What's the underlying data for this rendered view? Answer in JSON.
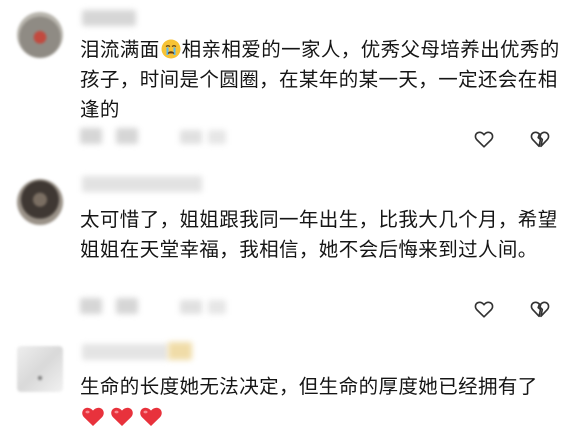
{
  "comments": [
    {
      "avatar_icon": "blurred-avatar",
      "text_before_emoji": "泪流满面",
      "emoji": "crying-face-icon",
      "text_after_emoji": "相亲相爱的一家人，优秀父母培养出优秀的孩子，时间是个圆圈，在某年的某一天，一定还会在相逢的",
      "like_icon": "heart-outline-icon",
      "dislike_icon": "broken-heart-icon"
    },
    {
      "avatar_icon": "blurred-avatar",
      "text": "太可惜了，姐姐跟我同一年出生，比我大几个月，希望姐姐在天堂幸福，我相信，她不会后悔来到过人间。",
      "like_icon": "heart-outline-icon",
      "dislike_icon": "broken-heart-icon"
    },
    {
      "avatar_icon": "blurred-avatar",
      "text": "生命的长度她无法决定，但生命的厚度她已经拥有了",
      "emoji_hearts": [
        "red-heart-icon",
        "red-heart-icon",
        "red-heart-icon"
      ]
    }
  ],
  "colors": {
    "text": "#151515",
    "icon": "#333333",
    "heart_red": "#e8323c"
  }
}
